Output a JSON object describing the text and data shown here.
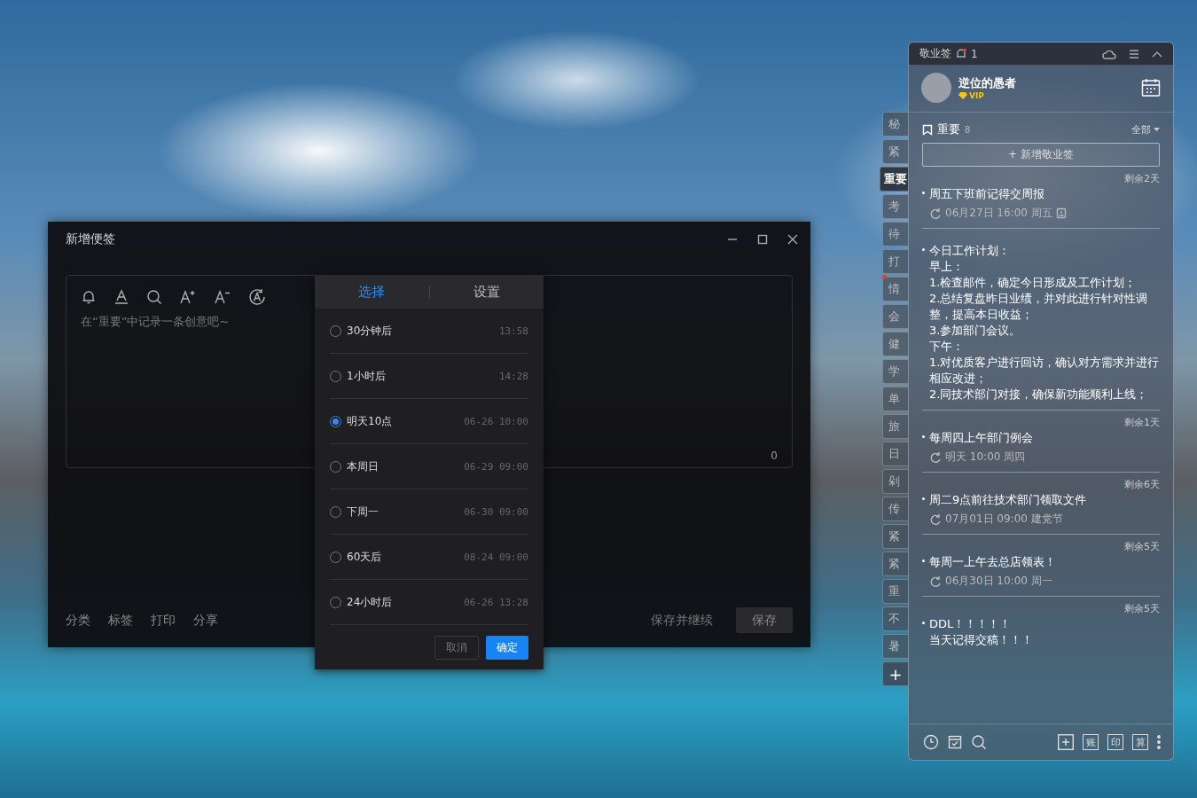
{
  "note_dialog": {
    "title": "新增便签",
    "placeholder": "在“重要”中记录一条创意吧~",
    "char_count": "0",
    "footer_links": [
      "分类",
      "标签",
      "打印",
      "分享"
    ],
    "save_continue": "保存并继续",
    "save": "保存"
  },
  "reminder_popup": {
    "tabs": [
      {
        "label": "选择",
        "selected": true
      },
      {
        "label": "设置",
        "selected": false
      }
    ],
    "options": [
      {
        "label": "30分钟后",
        "time": "13:58",
        "selected": false
      },
      {
        "label": "1小时后",
        "time": "14:28",
        "selected": false
      },
      {
        "label": "明天10点",
        "time": "06-26 10:00",
        "selected": true
      },
      {
        "label": "本周日",
        "time": "06-29 09:00",
        "selected": false
      },
      {
        "label": "下周一",
        "time": "06-30 09:00",
        "selected": false
      },
      {
        "label": "60天后",
        "time": "08-24 09:00",
        "selected": false
      },
      {
        "label": "24小时后",
        "time": "06-26 13:28",
        "selected": false
      }
    ],
    "cancel": "取消",
    "confirm": "确定"
  },
  "category_tabs": [
    {
      "label": "秘",
      "selected": false,
      "alert": false
    },
    {
      "label": "紧",
      "selected": false,
      "alert": false
    },
    {
      "label": "重要",
      "selected": true,
      "alert": false
    },
    {
      "label": "考",
      "selected": false,
      "alert": false
    },
    {
      "label": "待",
      "selected": false,
      "alert": false
    },
    {
      "label": "打",
      "selected": false,
      "alert": false
    },
    {
      "label": "情",
      "selected": false,
      "alert": true
    },
    {
      "label": "会",
      "selected": false,
      "alert": false
    },
    {
      "label": "健",
      "selected": false,
      "alert": false
    },
    {
      "label": "学",
      "selected": false,
      "alert": false
    },
    {
      "label": "单",
      "selected": false,
      "alert": false
    },
    {
      "label": "旅",
      "selected": false,
      "alert": false
    },
    {
      "label": "日",
      "selected": false,
      "alert": false
    },
    {
      "label": "剁",
      "selected": false,
      "alert": false
    },
    {
      "label": "传",
      "selected": false,
      "alert": false
    },
    {
      "label": "紧",
      "selected": false,
      "alert": false
    },
    {
      "label": "紧",
      "selected": false,
      "alert": false
    },
    {
      "label": "重",
      "selected": false,
      "alert": false
    },
    {
      "label": "不",
      "selected": false,
      "alert": false
    },
    {
      "label": "暑",
      "selected": false,
      "alert": false
    }
  ],
  "add_category": "+",
  "sticky_panel": {
    "app_name": "敬业签",
    "notification_count": "1",
    "user_name": "逆位的愚者",
    "vip_badge": "VIP",
    "category_name": "重要",
    "category_count": "8",
    "filter": "全部",
    "add_button": "+ 新增敬业签",
    "notes": [
      {
        "remaining": "剩余2天",
        "lines": [
          "周五下班前记得交周报"
        ],
        "meta": "06月27日 16:00 周五",
        "attachment": true
      },
      {
        "lines": [
          "今日工作计划：",
          "早上：",
          "1.检查邮件，确定今日形成及工作计划；",
          "2.总结复盘昨日业绩，并对此进行针对性调整，提高本日收益；",
          "3.参加部门会议。",
          "下午：",
          "1.对优质客户进行回访，确认对方需求并进行相应改进；",
          "2.同技术部门对接，确保新功能顺利上线；"
        ],
        "attachment": false
      },
      {
        "remaining": "剩余1天",
        "lines": [
          "每周四上午部门例会"
        ],
        "meta": "明天 10:00 周四",
        "attachment": false
      },
      {
        "remaining": "剩余6天",
        "lines": [
          "周二9点前往技术部门领取文件"
        ],
        "meta": "07月01日 09:00 建党节",
        "attachment": false
      },
      {
        "remaining": "剩余5天",
        "lines": [
          "每周一上午去总店领表！"
        ],
        "meta": "06月30日 10:00 周一",
        "attachment": false
      },
      {
        "remaining": "剩余5天",
        "lines": [
          "DDL！！！！！",
          "当天记得交稿！！！"
        ],
        "attachment": false
      }
    ],
    "tool_buttons": [
      "账",
      "印",
      "算"
    ]
  }
}
